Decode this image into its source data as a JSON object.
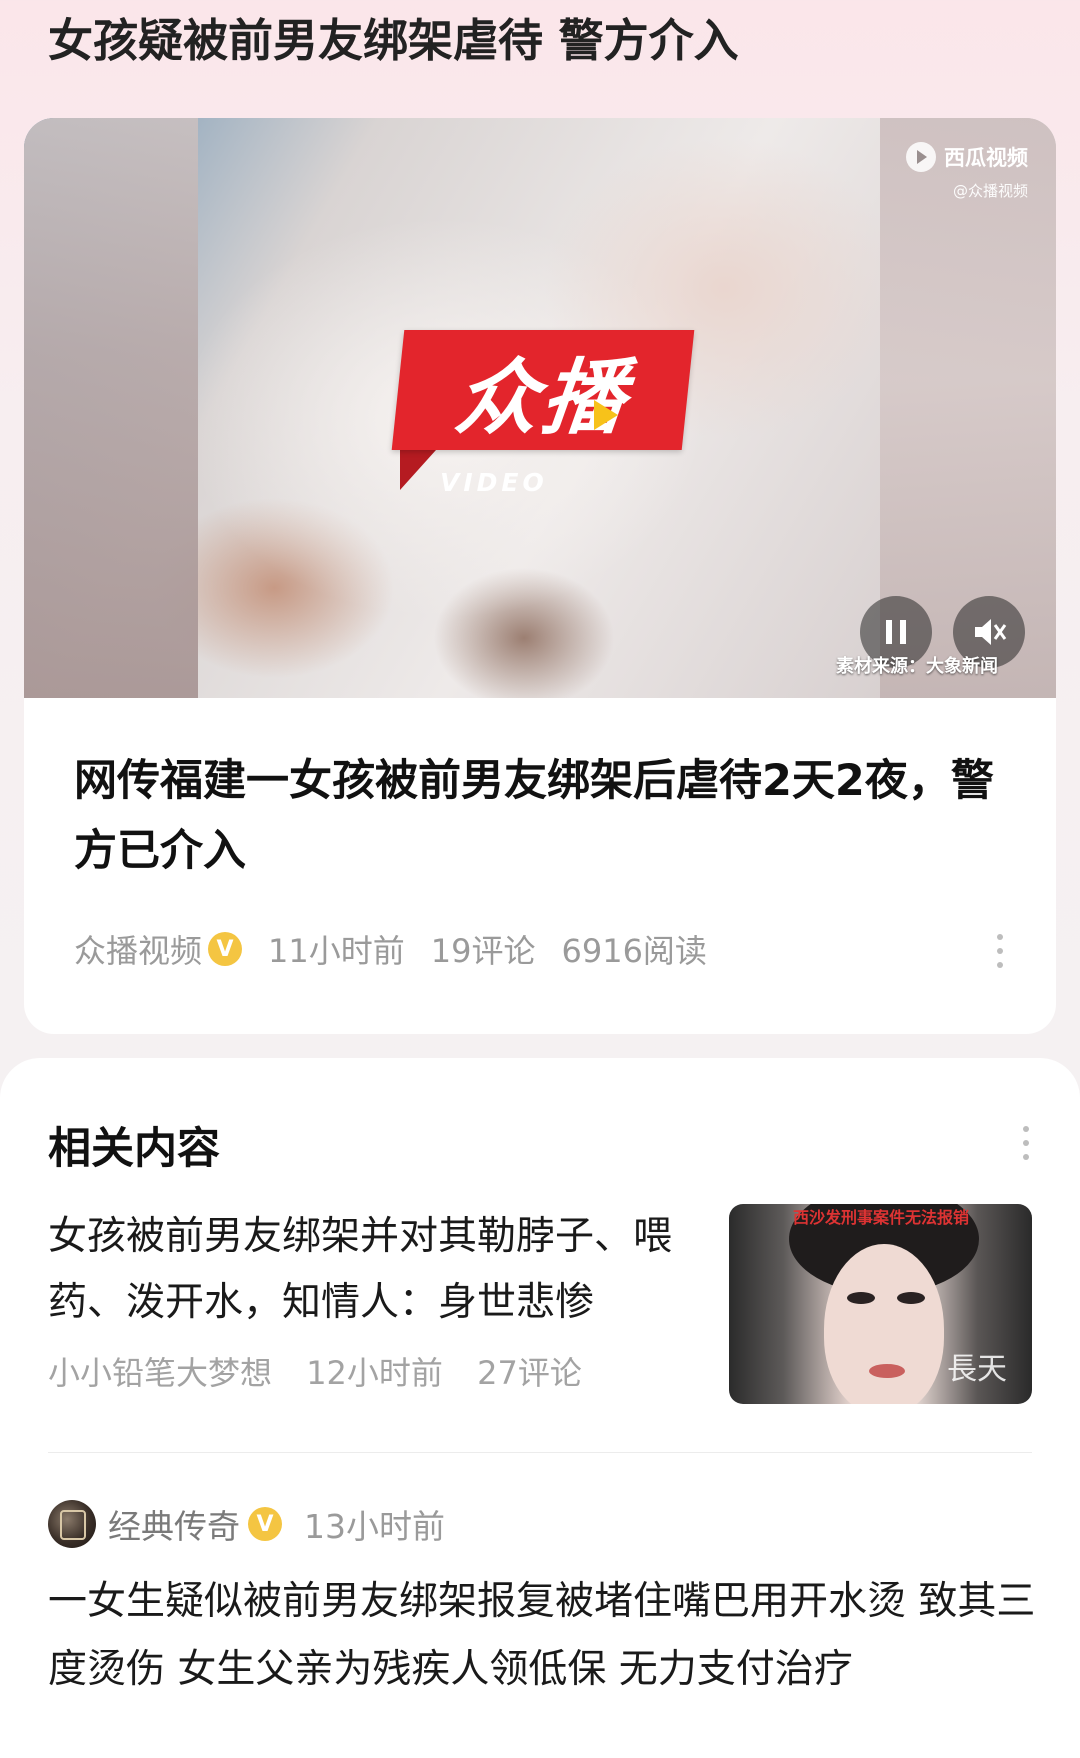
{
  "topic": {
    "title": "女孩疑被前男友绑架虐待 警方介入"
  },
  "video": {
    "logo_text": "众播",
    "logo_sub": "VIDEO",
    "watermark_name": "西瓜视频",
    "watermark_handle": "@众播视频",
    "source_caption": "素材来源：大象新闻",
    "pause_icon": "pause-icon",
    "mute_icon": "mute-icon"
  },
  "article": {
    "headline": "网传福建一女孩被前男友绑架后虐待2天2夜，警方已介入",
    "author": "众播视频",
    "verified_badge": "V",
    "time": "11小时前",
    "comments": "19评论",
    "reads": "6916阅读"
  },
  "related": {
    "title": "相关内容",
    "item1": {
      "title": "女孩被前男友绑架并对其勒脖子、喂药、泼开水，知情人：身世悲惨",
      "author": "小小铅笔大梦想",
      "time": "12小时前",
      "comments": "27评论",
      "thumb_watermark": "長天",
      "thumb_top_text": "西沙发刑事案件无法报销"
    },
    "item2": {
      "author": "经典传奇",
      "verified_badge": "V",
      "time": "13小时前",
      "text": "一女生疑似被前男友绑架报复被堵住嘴巴用开水烫 致其三度烫伤 女生父亲为残疾人领低保 无力支付治疗"
    }
  },
  "colors": {
    "brand_red": "#e3252c",
    "verified_gold": "#f4c542",
    "meta_gray": "#9a9a9a"
  }
}
